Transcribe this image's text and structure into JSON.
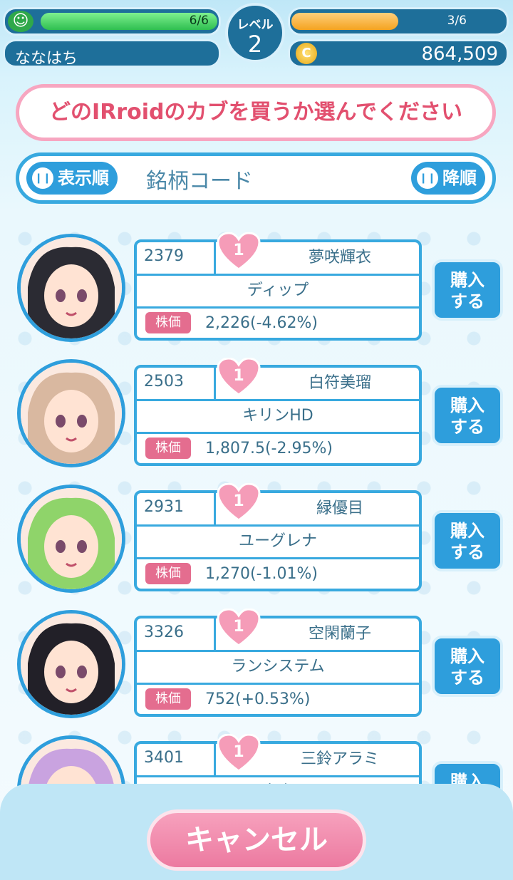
{
  "header": {
    "stamina": {
      "text": "6/6",
      "fraction": 1.0,
      "icon": "stamina-face-icon"
    },
    "player_name": "ななはち",
    "level": {
      "label": "レベル",
      "value": "2"
    },
    "exp": {
      "text": "3/6",
      "fraction": 0.5
    },
    "coins": {
      "value": "864,509",
      "icon": "coin-icon"
    }
  },
  "prompt": "どのIRroidのカブを買うか選んでください",
  "sort": {
    "order_button": "表示順",
    "key": "銘柄コード",
    "direction_button": "降順"
  },
  "price_label": "株価",
  "buy_label_1": "購入",
  "buy_label_2": "する",
  "stocks": [
    {
      "code": "2379",
      "name": "夢咲輝衣",
      "company": "ディップ",
      "price": "2,226(-4.62%)",
      "rank": "1"
    },
    {
      "code": "2503",
      "name": "白符美瑠",
      "company": "キリンHD",
      "price": "1,807.5(-2.95%)",
      "rank": "1"
    },
    {
      "code": "2931",
      "name": "緑優目",
      "company": "ユーグレナ",
      "price": "1,270(-1.01%)",
      "rank": "1"
    },
    {
      "code": "3326",
      "name": "空閑蘭子",
      "company": "ランシステム",
      "price": "752(+0.53%)",
      "rank": "1"
    },
    {
      "code": "3401",
      "name": "三鈴アラミ",
      "company": "帝人",
      "price": "",
      "rank": "1"
    }
  ],
  "cancel_button": "キャンセル",
  "colors": {
    "accent": "#2e9edc",
    "pink": "#e46d8f",
    "dark": "#1e6f9a"
  }
}
